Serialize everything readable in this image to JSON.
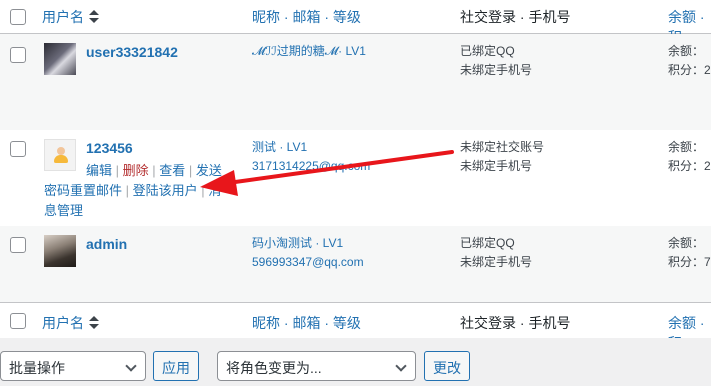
{
  "header": {
    "col_username": "用户名",
    "col_nickname": "昵称 · 邮箱 · 等级",
    "col_social": "社交登录 · 手机号",
    "col_balance": "余额 · 积"
  },
  "rows": [
    {
      "username": "user33321842",
      "nickname": "𝓜ℐℐ过期的糖𝓜· LV1",
      "email": "",
      "social": "已绑定QQ",
      "phone": "未绑定手机号",
      "balance": "余额：",
      "points": "积分：2",
      "avatar": "photo-avatar"
    },
    {
      "username": "123456",
      "nickname": "测试 · LV1",
      "email": "3171314225@qq.com",
      "social": "未绑定社交账号",
      "phone": "未绑定手机号",
      "balance": "余额：",
      "points": "积分：2",
      "avatar": "default-avatar",
      "actions": {
        "edit": "编辑",
        "delete": "删除",
        "view": "查看",
        "send_prefix": "发送",
        "send_rest": "密码重置邮件",
        "login_as": "登陆该用户",
        "msg_prefix": "消",
        "msg_rest": "息管理",
        "sep": " | "
      }
    },
    {
      "username": "admin",
      "nickname": "码小淘测试 · LV1",
      "email": "596993347@qq.com",
      "social": "已绑定QQ",
      "phone": "未绑定手机号",
      "balance": "余额：",
      "points": "积分：7",
      "avatar": "photo-avatar"
    }
  ],
  "bottom": {
    "bulk_label": "批量操作",
    "apply_label": "应用",
    "role_label": "将角色变更为...",
    "change_label": "更改"
  },
  "annotation": {
    "arrow_color": "#e8161b"
  }
}
